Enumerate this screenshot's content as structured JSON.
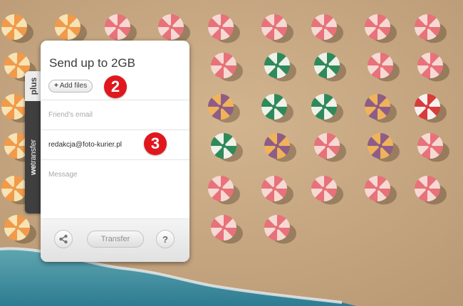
{
  "panel": {
    "title": "Send up to 2GB",
    "add_files_label": "Add files",
    "add_files_plus": "+",
    "email_placeholder": "Friend's email",
    "from_value": "redakcja@foto-kurier.pl",
    "message_placeholder": "Message",
    "transfer_label": "Transfer",
    "help_label": "?"
  },
  "side_tab": {
    "plus_label": "plus",
    "brand_bold": "we",
    "brand_light": "transfer"
  },
  "callouts": [
    "2",
    "3"
  ],
  "icons": {
    "share": "share-icon",
    "help": "question-icon"
  },
  "colors": {
    "badge": "#e1171e",
    "sand": "#c9ab86",
    "sea": "#3f8fa3"
  }
}
